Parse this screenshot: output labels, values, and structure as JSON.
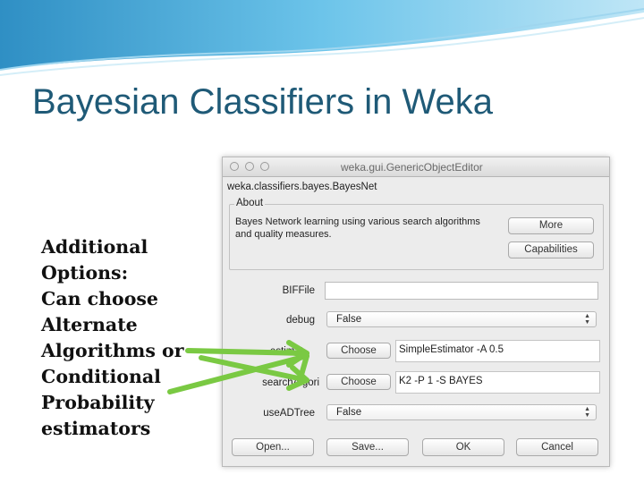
{
  "slide": {
    "title": "Bayesian Classifiers in Weka",
    "left_text_lines": [
      "Additional",
      "Options:",
      "Can choose",
      "Alternate",
      "Algorithms or",
      "Conditional",
      "Probability",
      "estimators"
    ]
  },
  "dialog": {
    "window_title": "weka.gui.GenericObjectEditor",
    "class_name": "weka.classifiers.bayes.BayesNet",
    "about": {
      "label": "About",
      "line1": "Bayes Network learning using various search algorithms",
      "line2": "and quality measures.",
      "more_label": "More",
      "capabilities_label": "Capabilities"
    },
    "properties": {
      "biffile_label": "BIFFile",
      "biffile_value": "",
      "debug_label": "debug",
      "debug_value": "False",
      "estimator_label": "estimat",
      "estimator_choose": "Choose",
      "estimator_value": "SimpleEstimator -A 0.5",
      "search_label": "searchAlgori",
      "search_choose": "Choose",
      "search_value": "K2 -P 1 -S BAYES",
      "useadtree_label": "useADTree",
      "useadtree_value": "False"
    },
    "buttons": {
      "open": "Open...",
      "save": "Save...",
      "ok": "OK",
      "cancel": "Cancel"
    }
  },
  "colors": {
    "title": "#1f5a77",
    "arrow": "#7ac943",
    "banner": "#4aa9d8"
  }
}
